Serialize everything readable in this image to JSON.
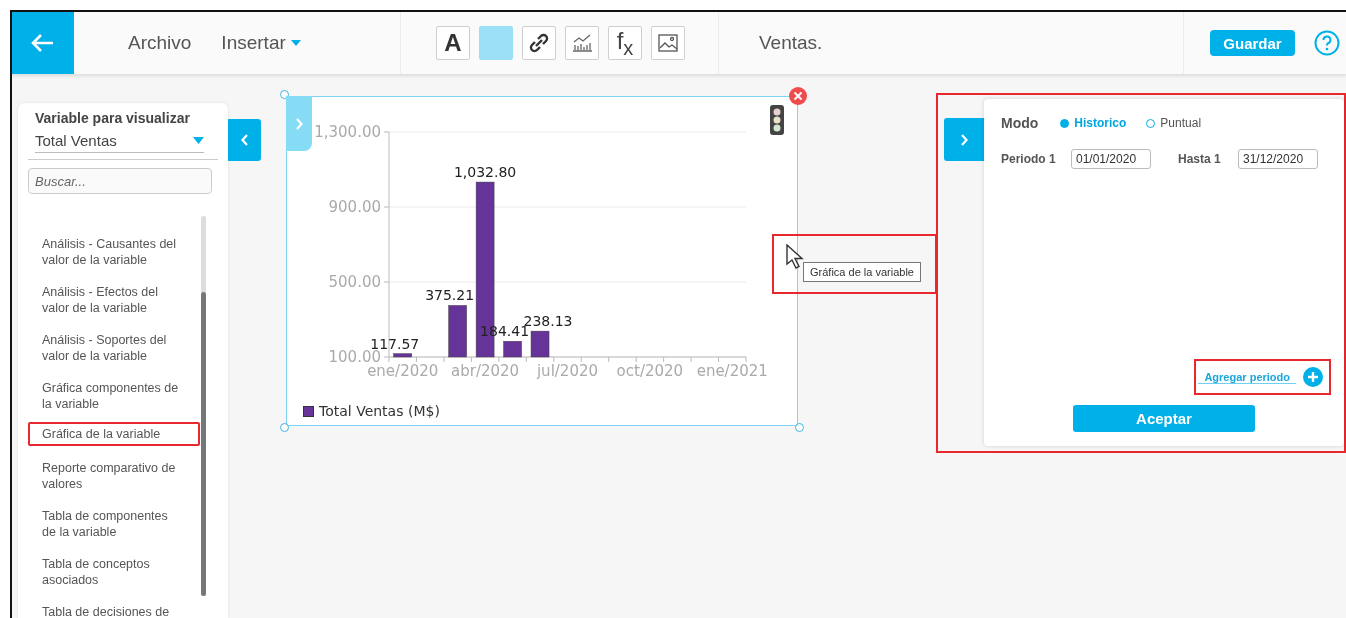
{
  "topbar": {
    "menu": [
      {
        "label": "Archivo",
        "dropdown": false
      },
      {
        "label": "Insertar",
        "dropdown": true
      }
    ],
    "toolbar": [
      {
        "kind": "text",
        "glyph": "A"
      },
      {
        "kind": "color"
      },
      {
        "kind": "link"
      },
      {
        "kind": "chart"
      },
      {
        "kind": "formula",
        "glyph": "f$_{x}$"
      },
      {
        "kind": "image"
      }
    ],
    "title": "Ventas.",
    "save_button": "Guardar"
  },
  "sidebar": {
    "heading": "Variable para visualizar",
    "variable": "Total Ventas",
    "search": {
      "placeholder": "Buscar..."
    },
    "items": [
      {
        "label": "Análisis - Causantes del valor de la variable",
        "highlighted": false
      },
      {
        "label": "Análisis - Efectos del valor de la variable",
        "highlighted": false
      },
      {
        "label": "Análisis - Soportes del valor de la variable",
        "highlighted": false
      },
      {
        "label": "Gráfica componentes de la variable",
        "highlighted": false
      },
      {
        "label": "Gráfica de la variable",
        "highlighted": true
      },
      {
        "label": "Reporte comparativo de valores",
        "highlighted": false
      },
      {
        "label": "Tabla de componentes de la variable",
        "highlighted": false
      },
      {
        "label": "Tabla de conceptos asociados",
        "highlighted": false
      },
      {
        "label": "Tabla de decisiones de",
        "highlighted": false
      }
    ]
  },
  "chart": {
    "chart_data": {
      "type": "bar",
      "categories": [
        "ene/2020",
        null,
        null,
        "abr/2020",
        null,
        null,
        "jul/2020",
        null,
        null,
        "oct/2020",
        null,
        null,
        "ene/2021"
      ],
      "series": [
        {
          "name": "Total Ventas (M$)",
          "color": "#663399",
          "values": [
            118,
            null,
            375,
            1033,
            184,
            238,
            null,
            null,
            null,
            null,
            null,
            null,
            null
          ]
        }
      ],
      "value_labels": [
        "117.57",
        null,
        "375.21",
        "1,032.80",
        "184.41",
        "238.13",
        null,
        null,
        null,
        null,
        null,
        null,
        null
      ],
      "ylim": [
        100,
        1300
      ],
      "yticks": [
        {
          "value": 100,
          "label": "100.00"
        },
        {
          "value": 500,
          "label": "500.00"
        },
        {
          "value": 900,
          "label": "900.00"
        },
        {
          "value": 1300,
          "label": "1,300.00"
        }
      ]
    }
  },
  "tooltip": "Gráfica de la variable",
  "period_panel": {
    "mode_label": "Modo",
    "modes": [
      {
        "label": "Historico",
        "selected": true
      },
      {
        "label": "Puntual",
        "selected": false
      }
    ],
    "periods": [
      {
        "from_label": "Periodo 1",
        "from": "01/01/2020",
        "to_label": "Hasta 1",
        "to": "31/12/2020"
      }
    ],
    "add_link": "Agregar periodo",
    "accept_button": "Aceptar"
  }
}
